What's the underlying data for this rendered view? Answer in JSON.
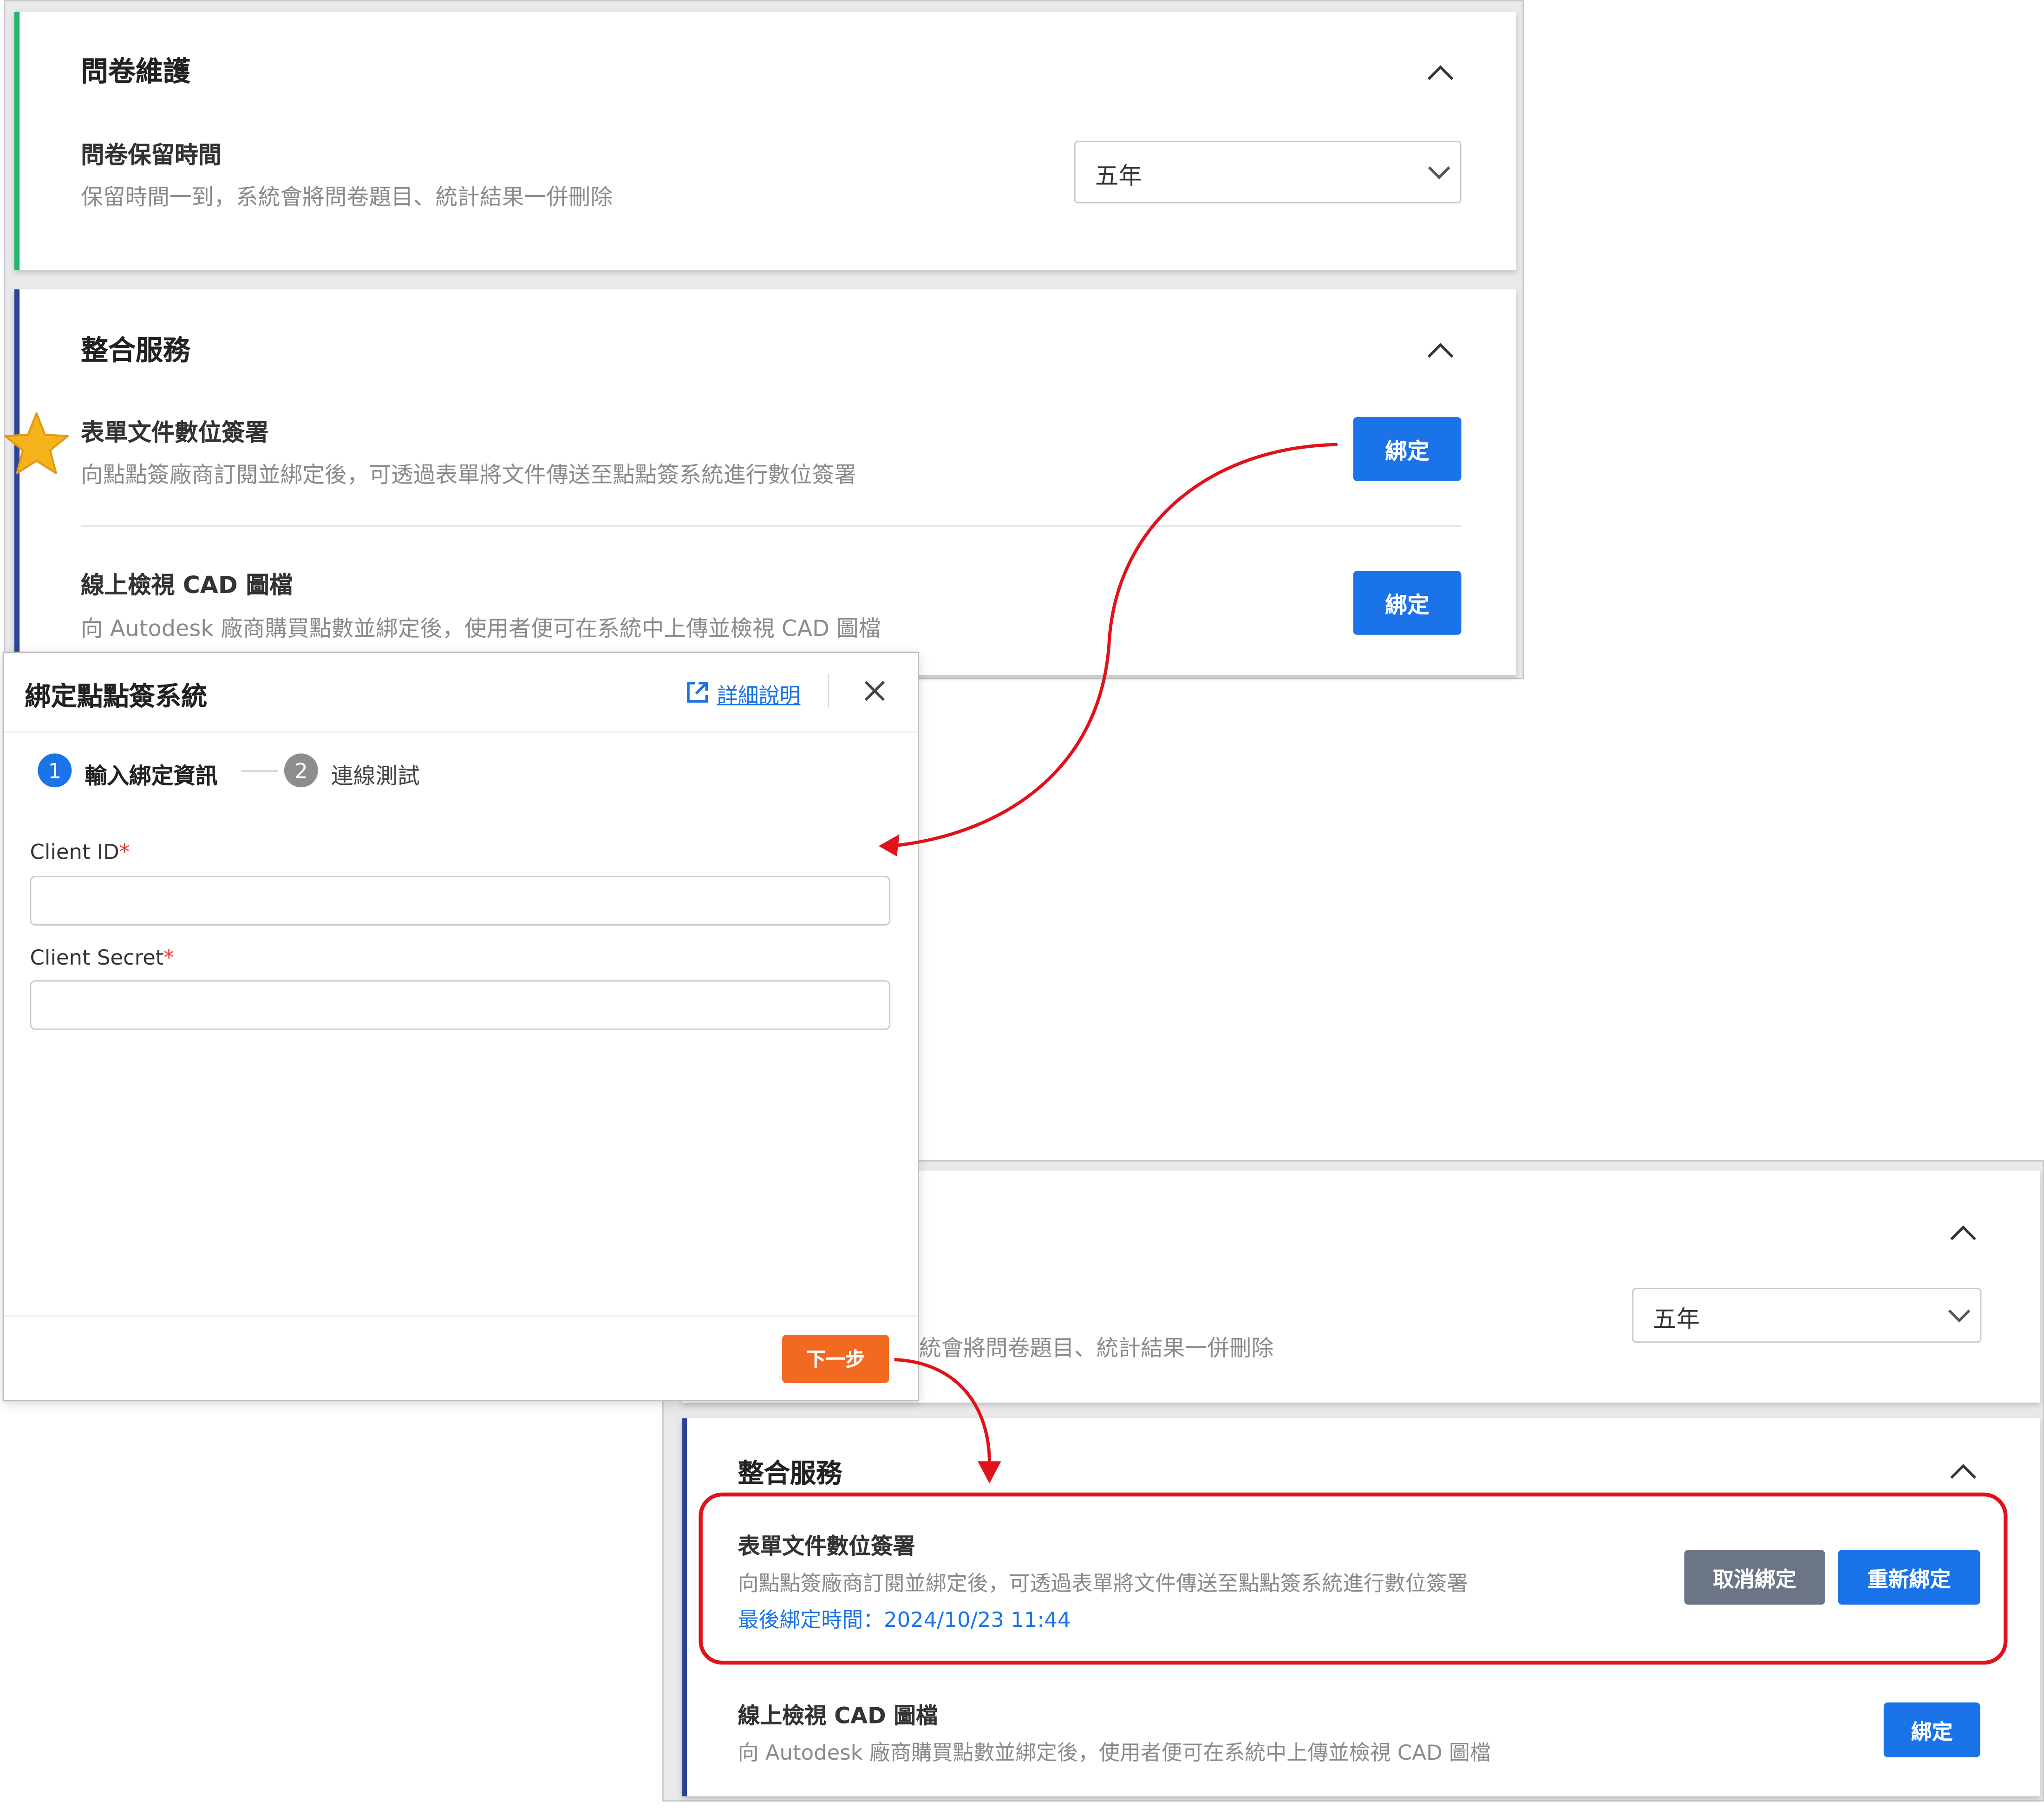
{
  "top_panel": {
    "survey_section": {
      "title": "問卷維護",
      "item_title": "問卷保留時間",
      "item_desc": "保留時間一到，系統會將問卷題目、統計結果一併刪除",
      "select_value": "五年"
    },
    "integration_section": {
      "title": "整合服務",
      "items": [
        {
          "title": "表單文件數位簽署",
          "desc": "向點點簽廠商訂閱並綁定後，可透過表單將文件傳送至點點簽系統進行數位簽署",
          "button": "綁定"
        },
        {
          "title": "線上檢視 CAD 圖檔",
          "desc": "向 Autodesk 廠商購買點數並綁定後，使用者便可在系統中上傳並檢視 CAD 圖檔",
          "button": "綁定"
        }
      ]
    }
  },
  "dialog": {
    "title": "綁定點點簽系統",
    "help_link": "詳細說明",
    "steps": [
      {
        "number": "1",
        "label": "輸入綁定資訊"
      },
      {
        "number": "2",
        "label": "連線測試"
      }
    ],
    "fields": [
      {
        "label": "Client ID",
        "required_mark": "*",
        "value": ""
      },
      {
        "label": "Client Secret",
        "required_mark": "*",
        "value": ""
      }
    ],
    "next_button": "下一步"
  },
  "bottom_panel": {
    "survey_desc_partial": "統會將問卷題目、統計結果一併刪除",
    "select_value": "五年",
    "integration_section": {
      "title": "整合服務",
      "items": [
        {
          "title": "表單文件數位簽署",
          "desc": "向點點簽廠商訂閱並綁定後，可透過表單將文件傳送至點點簽系統進行數位簽署",
          "last_bound": "最後綁定時間：2024/10/23 11:44",
          "unbind_button": "取消綁定",
          "rebind_button": "重新綁定"
        },
        {
          "title": "線上檢視 CAD 圖檔",
          "desc": "向 Autodesk 廠商購買點數並綁定後，使用者便可在系統中上傳並檢視 CAD 圖檔",
          "button": "綁定"
        }
      ]
    }
  },
  "colors": {
    "primary_blue": "#1a73e8",
    "survey_accent_green": "#1db86a",
    "integration_accent_navy": "#2b4594",
    "annotation_red": "#e0121a",
    "next_orange": "#f26a21",
    "unbind_gray": "#6b7585",
    "star_gold": "#f6b21b"
  }
}
